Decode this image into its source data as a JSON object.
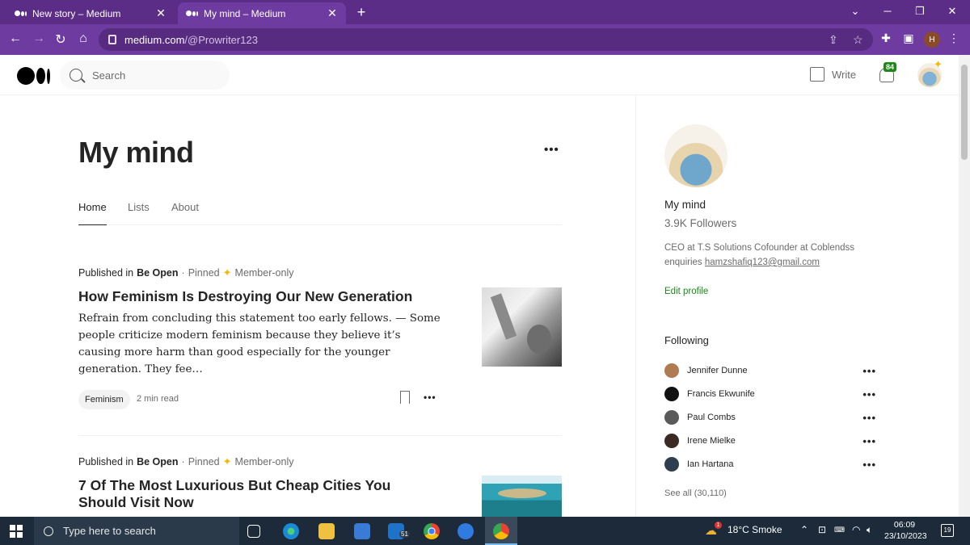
{
  "browser": {
    "tabs": [
      {
        "title": "New story – Medium"
      },
      {
        "title": "My mind – Medium"
      }
    ],
    "url_host": "medium.com",
    "url_path": "/@Prowriter123",
    "profile_initial": "H"
  },
  "header": {
    "search_placeholder": "Search",
    "write_label": "Write",
    "notification_count": "84"
  },
  "publication": {
    "title": "My mind",
    "tabs": [
      "Home",
      "Lists",
      "About"
    ],
    "active_tab": "Home"
  },
  "articles": [
    {
      "published_in_label": "Published in",
      "publication": "Be Open",
      "pinned": "Pinned",
      "member_only": "Member-only",
      "title": "How Feminism Is Destroying Our New Generation",
      "excerpt": "Refrain from concluding this statement too early fellows. — Some people criticize modern feminism because they believe it’s causing more harm than good especially for the younger generation. They fee…",
      "tag": "Feminism",
      "read_time": "2 min read"
    },
    {
      "published_in_label": "Published in",
      "publication": "Be Open",
      "pinned": "Pinned",
      "member_only": "Member-only",
      "title": "7 Of The Most Luxurious But Cheap Cities You Should Visit Now"
    }
  ],
  "sidebar": {
    "name": "My mind",
    "followers": "3.9K Followers",
    "bio": "CEO at T.S Solutions Cofounder at Coblendss enquiries ",
    "email": "hamzshafiq123@gmail.com",
    "edit_profile": "Edit profile",
    "following_heading": "Following",
    "following": [
      {
        "name": "Jennifer Dunne",
        "color": "#b07a52"
      },
      {
        "name": "Francis Ekwunife",
        "color": "#111111"
      },
      {
        "name": "Paul Combs",
        "color": "#5a5a5a"
      },
      {
        "name": "Irene Mielke",
        "color": "#3b2a22"
      },
      {
        "name": "Ian Hartana",
        "color": "#2c3e50"
      }
    ],
    "see_all": "See all (30,110)"
  },
  "taskbar": {
    "search_placeholder": "Type here to search",
    "mail_badge": "51",
    "weather": "18°C  Smoke",
    "weather_badge": "1",
    "time": "06:09",
    "date": "23/10/2023",
    "notifications": "19"
  }
}
